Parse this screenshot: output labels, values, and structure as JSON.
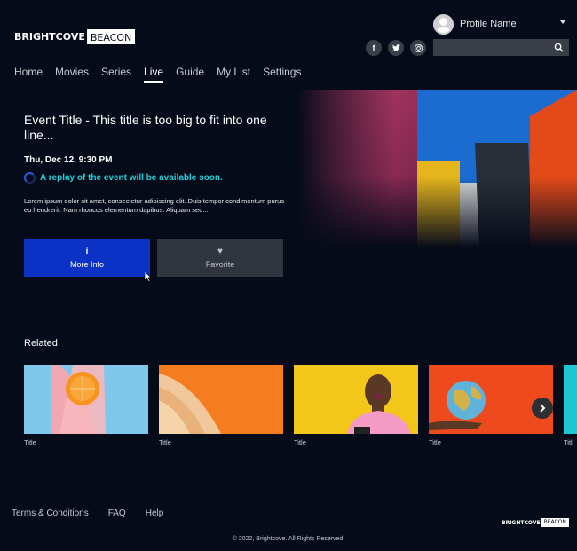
{
  "brand": {
    "logo_primary": "BRIGHTCOVE",
    "logo_secondary": "BEACON"
  },
  "profile": {
    "name": "Profile Name"
  },
  "social": [
    {
      "icon": "facebook-icon",
      "glyph": "f"
    },
    {
      "icon": "twitter-icon",
      "glyph": "t"
    },
    {
      "icon": "instagram-icon",
      "glyph": "◎"
    }
  ],
  "search": {
    "value": "",
    "placeholder": ""
  },
  "nav": {
    "items": [
      "Home",
      "Movies",
      "Series",
      "Live",
      "Guide",
      "My List",
      "Settings"
    ],
    "active": "Live"
  },
  "hero": {
    "title": "Event Title - This title is too big to fit into one line...",
    "date": "Thu, Dec 12, 9:30 PM",
    "replay": "A replay of the event will be available soon.",
    "description": "Lorem ipsum dolor sit amet, consectetur adipiscing elit. Duis tempor condimentum purus eu hendrerit. Nam rhoncus elementum dapibus. Aliquam sed...",
    "more_info_label": "More Info",
    "more_info_glyph": "i",
    "favorite_label": "Favorite",
    "favorite_glyph": "♥"
  },
  "related": {
    "heading": "Related",
    "items": [
      {
        "title": "Title"
      },
      {
        "title": "Title"
      },
      {
        "title": "Title"
      },
      {
        "title": "Title"
      },
      {
        "title": "Titl"
      }
    ]
  },
  "footer": {
    "links": [
      "Terms & Conditions",
      "FAQ",
      "Help"
    ],
    "copyright": "© 2022, Brightcove. All Rights Reserved."
  },
  "colors": {
    "background": "#060b19",
    "accent": "#0c31c5",
    "replay": "#24cfd8"
  }
}
